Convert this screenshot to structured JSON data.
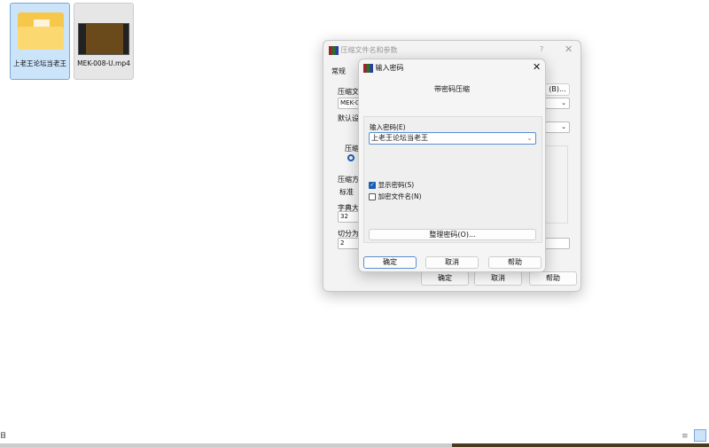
{
  "desktop": {
    "files": [
      {
        "name": "上老王论坛当老王"
      },
      {
        "name": "MEK-008-U.mp4"
      }
    ]
  },
  "back_dialog": {
    "title": "压缩文件名和参数",
    "help_q": "?",
    "tab": "常规",
    "labels": {
      "archive_name": "压缩文",
      "archive_value": "MEK-0",
      "browse": "(B)...",
      "default": "默认设",
      "format": "压缩",
      "method": "压缩方",
      "method_value": "标准",
      "dict": "字典大",
      "dict_value": "32",
      "split": "切分为",
      "split_value": "2"
    },
    "buttons": {
      "ok": "确定",
      "cancel": "取消",
      "help": "帮助"
    }
  },
  "dialog": {
    "title": "输入密码",
    "heading": "带密码压缩",
    "password_label": "输入密码(E)",
    "password_value": "上老王论坛当老王",
    "show_password": {
      "label": "显示密码(S)",
      "checked": true
    },
    "encrypt_names": {
      "label": "加密文件名(N)",
      "checked": false
    },
    "organize": "整理密码(O)...",
    "buttons": {
      "ok": "确定",
      "cancel": "取消",
      "help": "帮助"
    }
  },
  "statusbar": {
    "left_glyph": "目"
  }
}
